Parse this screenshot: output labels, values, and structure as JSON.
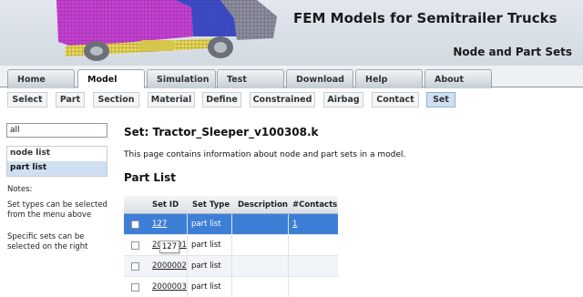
{
  "header": {
    "title": "FEM Models for Semitrailer Trucks",
    "subtitle": "Node and Part Sets"
  },
  "main_tabs": [
    {
      "label": "Home",
      "active": false
    },
    {
      "label": "Model",
      "active": true
    },
    {
      "label": "Simulation",
      "active": false
    },
    {
      "label": "Test",
      "active": false
    },
    {
      "label": "Download",
      "active": false
    },
    {
      "label": "Help",
      "active": false
    },
    {
      "label": "About",
      "active": false
    }
  ],
  "sub_tabs": [
    {
      "label": "Select",
      "active": false
    },
    {
      "label": "Part",
      "active": false
    },
    {
      "label": "Section",
      "active": false
    },
    {
      "label": "Material",
      "active": false
    },
    {
      "label": "Define",
      "active": false
    },
    {
      "label": "Constrained",
      "active": false
    },
    {
      "label": "Airbag",
      "active": false
    },
    {
      "label": "Contact",
      "active": false
    },
    {
      "label": "Set",
      "active": true
    }
  ],
  "sidebar": {
    "search_value": "all",
    "list": [
      {
        "label": "node list",
        "selected": false
      },
      {
        "label": "part list",
        "selected": true
      }
    ],
    "notes_label": "Notes:",
    "note1": "Set types can be selected from the menu above",
    "note2": "Specific sets can be selected on the right"
  },
  "content": {
    "set_title": "Set: Tractor_Sleeper_v100308.k",
    "description": "This page contains information about node and part sets in a model.",
    "section_title": "Part List"
  },
  "table": {
    "headers": [
      "Set ID",
      "Set Type",
      "Description",
      "#Contacts"
    ],
    "rows": [
      {
        "id": "127",
        "type": "part list",
        "description": "",
        "contacts": "1",
        "selected": true
      },
      {
        "id": "2000001",
        "type": "part list",
        "description": "",
        "contacts": "",
        "selected": false
      },
      {
        "id": "2000002",
        "type": "part list",
        "description": "",
        "contacts": "",
        "selected": false
      },
      {
        "id": "2000003",
        "type": "part list",
        "description": "",
        "contacts": "",
        "selected": false
      }
    ]
  },
  "tooltip": "127",
  "colors": {
    "accent_selected_row": "#3d7fd6",
    "selected_tab": "#cfe0f2",
    "truck_magenta": "#c63fd0",
    "truck_yellow": "#e8d84a",
    "truck_blue": "#3a4cc8"
  }
}
